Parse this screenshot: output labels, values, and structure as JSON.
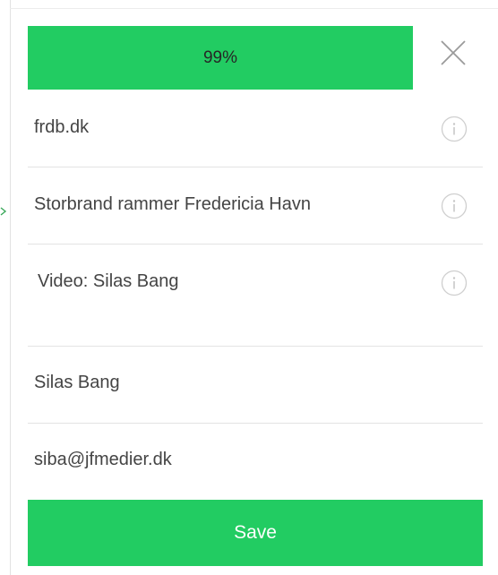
{
  "upload": {
    "progress_percent": 99,
    "progress_label": "99%",
    "fill_color": "#22cc62",
    "close_icon": "close-icon"
  },
  "fields": [
    {
      "value": "frdb.dk",
      "has_info": true
    },
    {
      "value": "Storbrand rammer Fredericia Havn",
      "has_info": true
    },
    {
      "value": "Video: Silas Bang",
      "has_info": true
    },
    {
      "value": "Silas Bang",
      "has_info": false
    },
    {
      "value": "siba@jfmedier.dk",
      "has_info": false
    }
  ],
  "info_icon": "info-icon",
  "save": {
    "label": "Save",
    "color": "#22cc62"
  }
}
